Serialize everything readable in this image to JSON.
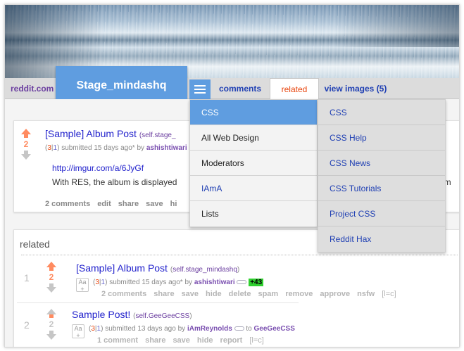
{
  "header": {
    "reddit_link": "reddit.com",
    "subreddit_title": "Stage_mindashq",
    "tabs": [
      "comments",
      "related",
      "view images (5)"
    ],
    "active_tab": "related"
  },
  "menu_left": [
    "CSS",
    "All Web Design",
    "Moderators",
    "IAmA",
    "Lists"
  ],
  "menu_right": [
    "CSS",
    "CSS Help",
    "CSS News",
    "CSS Tutorials",
    "Project CSS",
    "Reddit Hax"
  ],
  "post": {
    "score": "2",
    "title": "[Sample] Album Post",
    "domain": "(self.stage_",
    "votes_up": "3",
    "votes_down": "1",
    "submitted": "submitted 15 days ago* by",
    "author": "ashishtiwari",
    "link": "http://imgur.com/a/6JyGf",
    "body": "With RES, the album is displayed",
    "body_tail": "um",
    "actions": [
      "2 comments",
      "edit",
      "share",
      "save",
      "hi"
    ]
  },
  "related": {
    "header": "related",
    "rows": [
      {
        "rank": "1",
        "score": "2",
        "title": "[Sample] Album Post",
        "domain": "self.stage_mindashq",
        "votes_up": "3",
        "votes_down": "1",
        "submitted": "submitted 15 days ago* by",
        "author": "ashishtiwari",
        "karma": "+43",
        "actions": [
          "2 comments",
          "share",
          "save",
          "hide",
          "delete",
          "spam",
          "remove",
          "approve",
          "nsfw"
        ],
        "tag": "[l=c]"
      },
      {
        "rank": "2",
        "score": "2",
        "title": "Sample Post!",
        "domain": "self.GeeGeeCSS",
        "votes_up": "3",
        "votes_down": "1",
        "submitted": "submitted 13 days ago by",
        "author": "iAmReynolds",
        "to": "to",
        "subreddit": "GeeGeeCSS",
        "actions": [
          "1 comment",
          "share",
          "save",
          "hide",
          "report"
        ],
        "tag": "[l=c]"
      }
    ]
  },
  "colors": {
    "accent": "#5f9de0",
    "link": "#2222cc",
    "upvote": "#ff8b60",
    "active_tab": "#e8440c",
    "karma": "#2fd02f"
  }
}
